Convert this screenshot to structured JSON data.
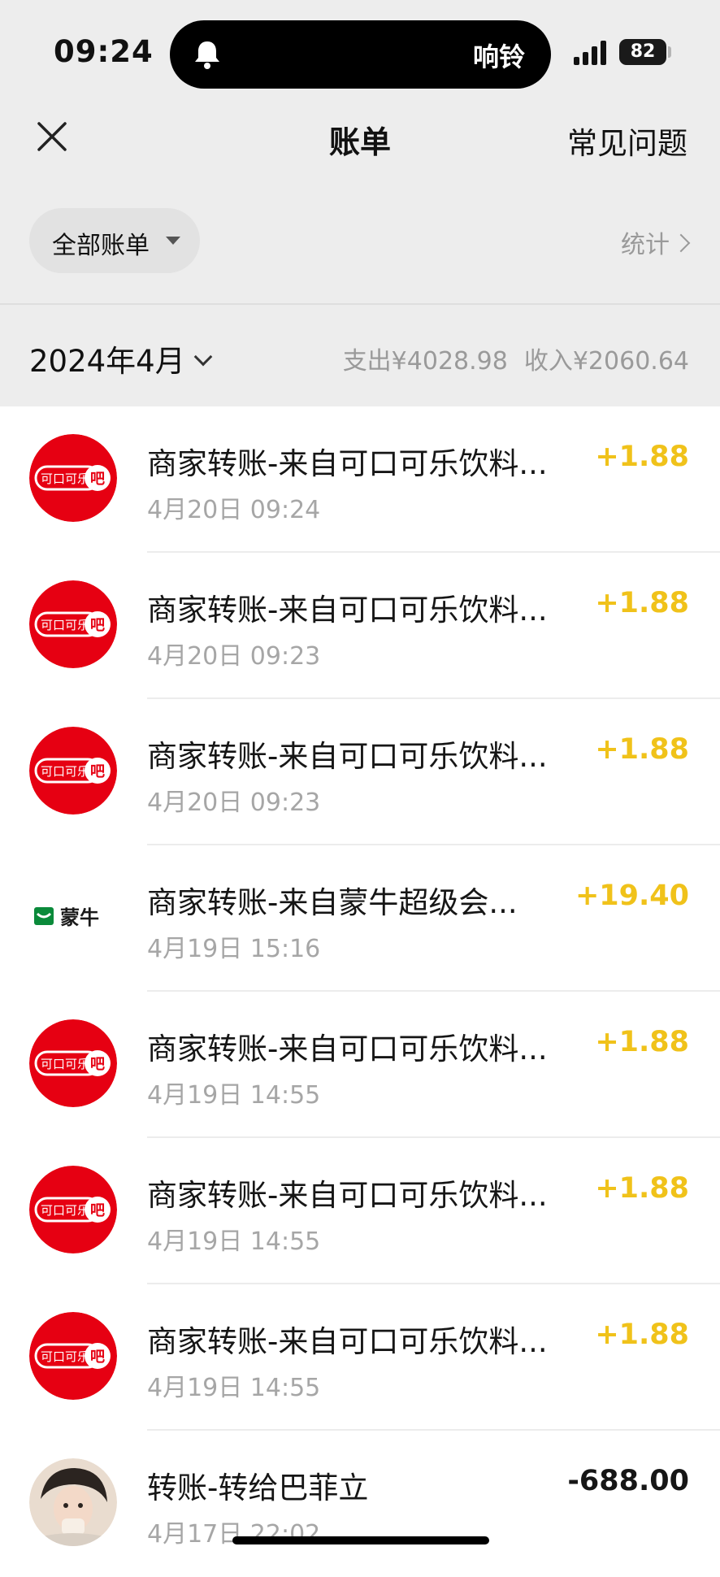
{
  "status_bar": {
    "time": "09:24",
    "island_label": "响铃",
    "battery": "82"
  },
  "nav": {
    "title": "账单",
    "faq": "常见问题"
  },
  "filter": {
    "label": "全部账单",
    "stats": "统计"
  },
  "month": {
    "label": "2024年4月",
    "expense": "支出¥4028.98",
    "income": "收入¥2060.64"
  },
  "colors": {
    "income_amount": "#f0c21a",
    "coke_red": "#e60012",
    "mengniu_green": "#0a8a3a"
  },
  "transactions": [
    {
      "logo": "coke-bar-logo",
      "logo_text": "可口可乐吧",
      "title": "商家转账-来自可口可乐饮料...",
      "time": "4月20日 09:24",
      "amount": "+1.88",
      "kind": "in"
    },
    {
      "logo": "coke-bar-logo",
      "logo_text": "可口可乐吧",
      "title": "商家转账-来自可口可乐饮料...",
      "time": "4月20日 09:23",
      "amount": "+1.88",
      "kind": "in"
    },
    {
      "logo": "coke-bar-logo",
      "logo_text": "可口可乐吧",
      "title": "商家转账-来自可口可乐饮料...",
      "time": "4月20日 09:23",
      "amount": "+1.88",
      "kind": "in"
    },
    {
      "logo": "mengniu-logo",
      "logo_text": "蒙牛",
      "title": "商家转账-来自蒙牛超级会...",
      "time": "4月19日 15:16",
      "amount": "+19.40",
      "kind": "in"
    },
    {
      "logo": "coke-bar-logo",
      "logo_text": "可口可乐吧",
      "title": "商家转账-来自可口可乐饮料...",
      "time": "4月19日 14:55",
      "amount": "+1.88",
      "kind": "in"
    },
    {
      "logo": "coke-bar-logo",
      "logo_text": "可口可乐吧",
      "title": "商家转账-来自可口可乐饮料...",
      "time": "4月19日 14:55",
      "amount": "+1.88",
      "kind": "in"
    },
    {
      "logo": "coke-bar-logo",
      "logo_text": "可口可乐吧",
      "title": "商家转账-来自可口可乐饮料...",
      "time": "4月19日 14:55",
      "amount": "+1.88",
      "kind": "in"
    },
    {
      "logo": "user-avatar",
      "logo_text": "",
      "title": "转账-转给巴菲立",
      "time": "4月17日 22:02",
      "amount": "-688.00",
      "kind": "out"
    }
  ]
}
